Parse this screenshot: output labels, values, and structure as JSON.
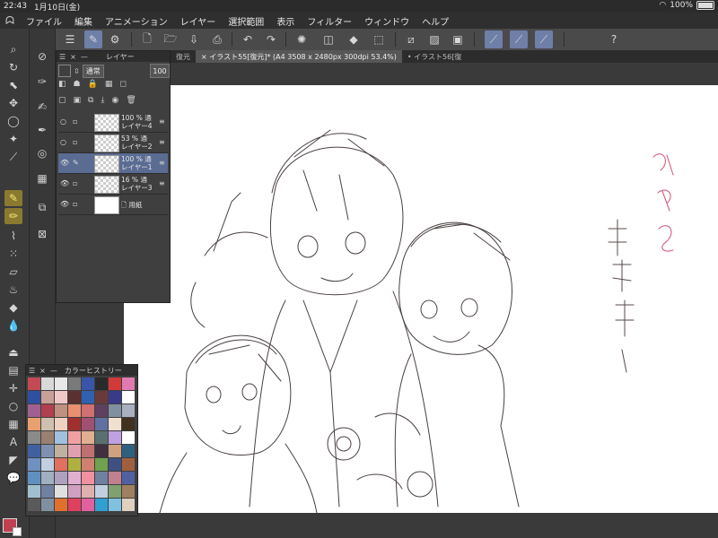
{
  "status": {
    "time": "22:43",
    "date": "1月10日(金)",
    "battery": "100%"
  },
  "menu": {
    "logo": "ᗣ",
    "items": [
      "ファイル",
      "編集",
      "アニメーション",
      "レイヤー",
      "選択範囲",
      "表示",
      "フィルター",
      "ウィンドウ",
      "ヘルプ"
    ]
  },
  "tabs": [
    {
      "label": "復元"
    },
    {
      "label": "イラスト55[復元]* (A4 3508 x 2480px 300dpi 53.4%)"
    },
    {
      "label": "イラスト56[復"
    }
  ],
  "layer_panel": {
    "title": "レイヤー",
    "blend_mode": "通常",
    "opacity": "100",
    "layers": [
      {
        "opacity": "100 %",
        "name": "レイヤー4",
        "suffix": "通"
      },
      {
        "opacity": "53 %",
        "name": "レイヤー2",
        "suffix": "通"
      },
      {
        "opacity": "100 %",
        "name": "レイヤー1",
        "suffix": "通"
      },
      {
        "opacity": "16 %",
        "name": "レイヤー3",
        "suffix": "通"
      },
      {
        "opacity": "",
        "name": "",
        "suffix": "用紙"
      }
    ]
  },
  "color_panel": {
    "title": "カラーヒストリー",
    "swatches": [
      "#c24a55",
      "#d9d9d9",
      "#e8e8e8",
      "#7a7a7a",
      "#3a55a8",
      "#2a2a2a",
      "#d23a3a",
      "#e07ab0",
      "#2f4fa0",
      "#c8a098",
      "#f0c8c8",
      "#5a3030",
      "#3060b0",
      "#6a3a3a",
      "#3a3a8a",
      "#ffffff",
      "#a06090",
      "#b04050",
      "#c09080",
      "#e89070",
      "#d07070",
      "#604060",
      "#8090a0",
      "#aab0c0",
      "#e8a070",
      "#d0c0b0",
      "#f0d0c0",
      "#a03030",
      "#a05070",
      "#6070a0",
      "#f0e0d0",
      "#403020",
      "#8a8a8a",
      "#9a8070",
      "#a0c0e0",
      "#f0a0a0",
      "#e0b090",
      "#5a7070",
      "#c0a0e0",
      "#ffffff",
      "#4060a0",
      "#8090b0",
      "#c0b0a0",
      "#e0a0b0",
      "#c07070",
      "#403040",
      "#d0a080",
      "#306080",
      "#7090c0",
      "#c0d0e0",
      "#e07060",
      "#b0b040",
      "#d08070",
      "#70a050",
      "#405080",
      "#a06040",
      "#6090c0",
      "#a0b0c0",
      "#b0a0c0",
      "#e0b0d0",
      "#f090a0",
      "#7080a0",
      "#c08090",
      "#5060a0",
      "#a0c0d0",
      "#7080a0",
      "#e0e0e0",
      "#d0a0c0",
      "#e0b0b0",
      "#c0d0e0",
      "#80a070",
      "#a08060",
      "#5a5a5a",
      "#8090a0",
      "#e07030",
      "#e04060",
      "#e060a0",
      "#30a0d0",
      "#80c0e0",
      "#e0d0c0"
    ]
  }
}
